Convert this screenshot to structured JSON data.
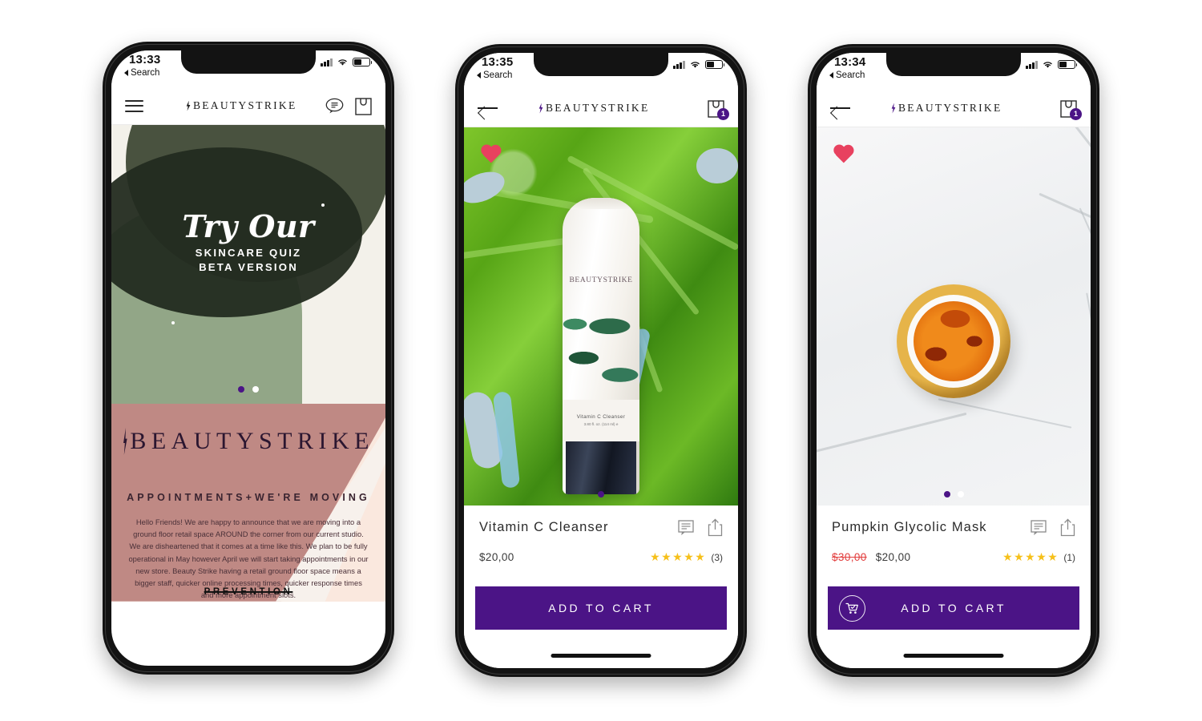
{
  "app": {
    "brand": "BEAUTYSTRIKE",
    "accent": "#4b1486",
    "star_color": "#f6c01a",
    "sale_color": "#e23c3c"
  },
  "phones": [
    {
      "id": "home",
      "status": {
        "time": "13:33",
        "back_label": "Search"
      },
      "nav": {
        "menu_icon": "hamburger-icon",
        "chat_icon": "chat-bubble-icon",
        "bag_icon": "shopping-bag-icon"
      },
      "hero": {
        "script_line": "Try Our",
        "sub_line_1": "SKINCARE QUIZ",
        "sub_line_2": "BETA VERSION",
        "colors": {
          "cream": "#f3f1ea",
          "sage": "#92a687",
          "olive": "#49523f",
          "dark_olive": "#232b20"
        },
        "dots": 2,
        "active_dot": 0
      },
      "panel": {
        "logo_word": "BEAUTYSTRIKE",
        "heading": "APPOINTMENTS+WE'RE MOVING",
        "body": "Hello Friends! We are happy to announce that we are moving into a ground floor retail space AROUND the corner from our current studio. We are disheartened that it comes at a time like this. We plan to be fully operational in May however April we will start taking appointments in our new store. Beauty Strike having a retail ground floor space means a bigger staff, quicker online processing times, quicker response times and more appointment slots.",
        "footer": "PREVENTION",
        "colors": {
          "rose": "#bf8984",
          "peach": "#fae8de",
          "cream": "#f7f1ec"
        }
      }
    },
    {
      "id": "vitamin-c-cleanser",
      "status": {
        "time": "13:35",
        "back_label": "Search"
      },
      "nav": {
        "back_icon": "back-arrow-icon",
        "bag_icon": "shopping-bag-icon",
        "cart_count": "1"
      },
      "media": {
        "type": "photo",
        "subject": "white cleanser tube on monstera leaves",
        "tube_brand": "BEAUTYSTRIKE",
        "tube_label_line1": "Vitamin C Cleanser",
        "tube_label_line2": "3.80 fl. oz. (114 ml)  e",
        "favorited": true
      },
      "product": {
        "name": "Vitamin C Cleanser",
        "price": "$20,00",
        "old_price": "",
        "rating": 5,
        "review_count": "(3)",
        "cta": "ADD TO CART",
        "review_icon": "review-bubble-icon",
        "share_icon": "share-icon"
      }
    },
    {
      "id": "pumpkin-glycolic-mask",
      "status": {
        "time": "13:34",
        "back_label": "Search"
      },
      "nav": {
        "back_icon": "back-arrow-icon",
        "bag_icon": "shopping-bag-icon",
        "cart_count": "1"
      },
      "media": {
        "type": "photo",
        "subject": "open gold jar of orange pumpkin mask on white marble",
        "favorited": true,
        "dots": 2,
        "active_dot": 0
      },
      "product": {
        "name": "Pumpkin Glycolic Mask",
        "price": "$20,00",
        "old_price": "$30,00",
        "rating": 5,
        "review_count": "(1)",
        "cta": "ADD TO CART",
        "review_icon": "review-bubble-icon",
        "share_icon": "share-icon",
        "cart_icon": "cart-check-icon"
      }
    }
  ],
  "stars_glyph": "★★★★★"
}
